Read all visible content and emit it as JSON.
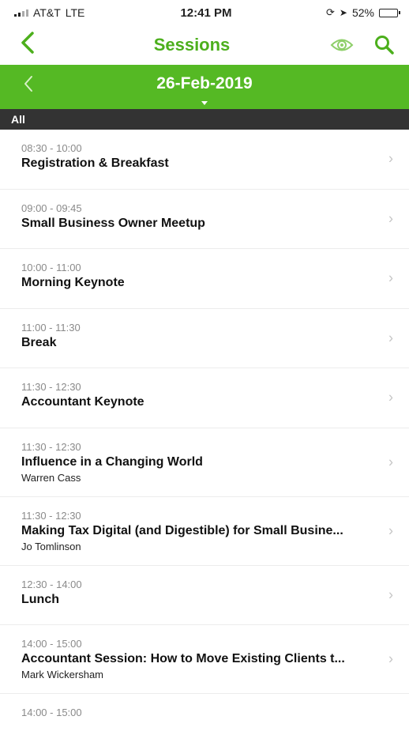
{
  "status": {
    "carrier": "AT&T",
    "network": "LTE",
    "time": "12:41 PM",
    "battery": "52%",
    "battery_level": 0.52
  },
  "nav": {
    "title": "Sessions",
    "back_icon": "chevron-left-icon",
    "actions": [
      "eye-icon",
      "search-icon"
    ],
    "accent_color": "#4caf1c"
  },
  "date_bar": {
    "date": "26-Feb-2019",
    "background": "#55b924"
  },
  "filter": {
    "label": "All"
  },
  "sessions": [
    {
      "time": "08:30 - 10:00",
      "title": "Registration & Breakfast",
      "speaker": ""
    },
    {
      "time": "09:00 - 09:45",
      "title": "Small Business Owner Meetup",
      "speaker": ""
    },
    {
      "time": "10:00 - 11:00",
      "title": "Morning Keynote",
      "speaker": ""
    },
    {
      "time": "11:00 - 11:30",
      "title": "Break",
      "speaker": ""
    },
    {
      "time": "11:30 - 12:30",
      "title": "Accountant Keynote",
      "speaker": ""
    },
    {
      "time": "11:30 - 12:30",
      "title": "Influence in a Changing World",
      "speaker": "Warren Cass"
    },
    {
      "time": "11:30 - 12:30",
      "title": "Making Tax Digital (and Digestible) for Small Busine...",
      "speaker": "Jo Tomlinson"
    },
    {
      "time": "12:30 - 14:00",
      "title": "Lunch",
      "speaker": ""
    },
    {
      "time": "14:00 - 15:00",
      "title": "Accountant Session: How to Move Existing Clients t...",
      "speaker": "Mark Wickersham"
    },
    {
      "time": "14:00 - 15:00",
      "title": "",
      "speaker": ""
    }
  ]
}
